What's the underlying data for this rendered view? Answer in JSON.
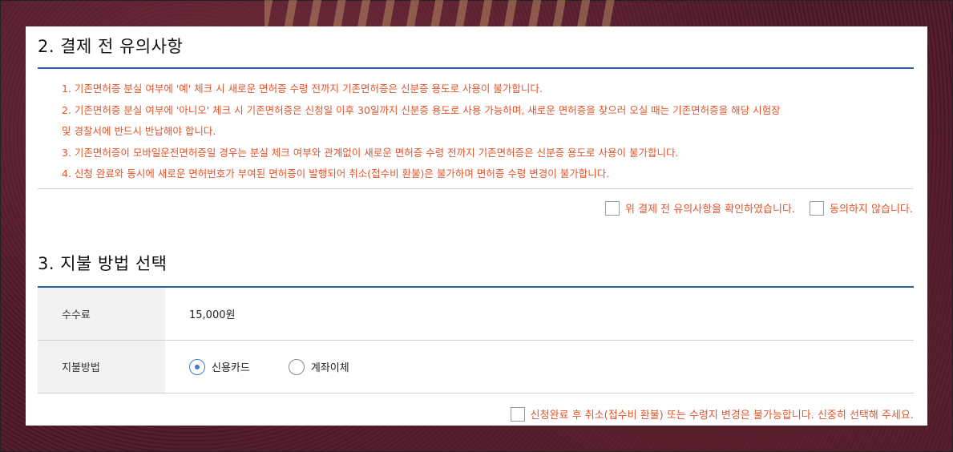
{
  "section2": {
    "title": "2. 결제 전 유의사항",
    "notes": [
      "1. 기존면허증 분실 여부에 '예' 체크 시 새로운 면허증 수령 전까지 기존면허증은 신분증 용도로 사용이 불가합니다.",
      "2. 기존면허증 분실 여부에 '아니오' 체크 시 기존면허증은 신청일 이후 30일까지 신분증 용도로 사용 가능하며, 새로운 면허증을 찾으러 오실 때는 기존면허증을 해당 시험장",
      "및 경찰서에 반드시 반납해야 합니다.",
      "3. 기존면허증이 모바일운전면허증일 경우는 분실 체크 여부와 관계없이 새로운 면허증 수령 전까지 기존면허증은 신분증 용도로 사용이 불가합니다.",
      "4. 신청 완료와 동시에 새로운 면허번호가 부여된 면허증이 발행되어 취소(접수비 환불)은 불가하며 면허증 수령 변경이 불가합니다."
    ],
    "agree_label": "위 결제 전 유의사항을 확인하였습니다.",
    "disagree_label": "동의하지 않습니다."
  },
  "section3": {
    "title": "3. 지불 방법 선택",
    "fee_label": "수수료",
    "fee_value": "15,000원",
    "method_label": "지불방법",
    "methods": [
      {
        "label": "신용카드",
        "selected": true
      },
      {
        "label": "계좌이체",
        "selected": false
      }
    ],
    "final_notice": "신청완료 후 취소(접수비 환불) 또는 수령지 변경은 불가능합니다. 신중히 선택해 주세요."
  },
  "colors": {
    "accent_blue": "#2c5f9e",
    "notice_orange": "#e2552a",
    "radio_blue": "#3e7cc7"
  }
}
